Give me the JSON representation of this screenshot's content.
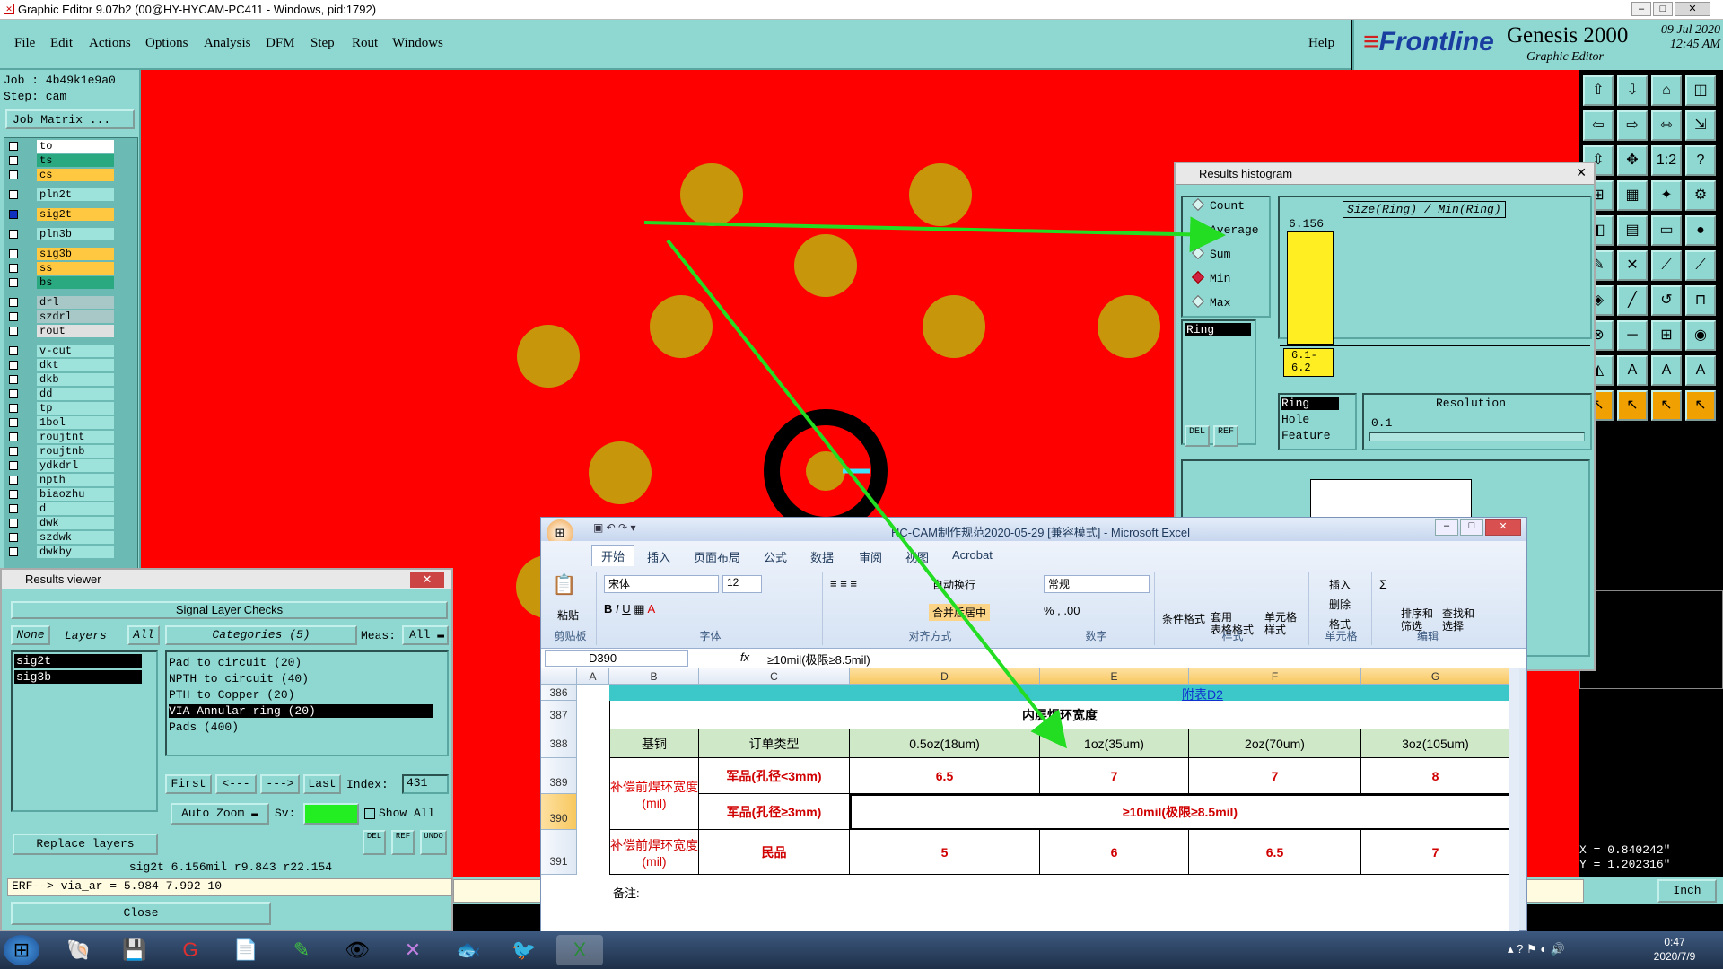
{
  "window": {
    "title": "Graphic Editor 9.07b2 (00@HY-HYCAM-PC411 - Windows, pid:1792)"
  },
  "menu": [
    "File",
    "Edit",
    "Actions",
    "Options",
    "Analysis",
    "DFM",
    "Step",
    "Rout",
    "Windows"
  ],
  "help": "Help",
  "brand": {
    "logo": "Frontline",
    "product": "Genesis 2000",
    "subtitle": "Graphic Editor",
    "date": "09 Jul 2020",
    "time": "12:45 AM"
  },
  "job": {
    "job_label": "Job : 4b49k1e9a0",
    "step_label": "Step: cam",
    "matrix_button": "Job Matrix ..."
  },
  "layers": [
    {
      "name": "to",
      "color": "#ffffff",
      "on": false
    },
    {
      "name": "ts",
      "color": "#2aa880",
      "on": false
    },
    {
      "name": "cs",
      "color": "#ffc840",
      "on": false
    },
    {
      "name": "pln2t",
      "color": "",
      "on": false
    },
    {
      "name": "sig2t",
      "color": "#ffc840",
      "on": true
    },
    {
      "name": "pln3b",
      "color": "",
      "on": false
    },
    {
      "name": "sig3b",
      "color": "#ffc840",
      "on": false
    },
    {
      "name": "ss",
      "color": "#ffc840",
      "on": false
    },
    {
      "name": "bs",
      "color": "#2aa880",
      "on": false
    },
    {
      "name": "drl",
      "color": "#a8c8c8",
      "on": false
    },
    {
      "name": "szdrl",
      "color": "#a8c8c8",
      "on": false
    },
    {
      "name": "rout",
      "color": "#e0e0e0",
      "on": false
    },
    {
      "name": "v-cut",
      "color": "",
      "on": false
    },
    {
      "name": "dkt",
      "color": "",
      "on": false
    },
    {
      "name": "dkb",
      "color": "",
      "on": false
    },
    {
      "name": "dd",
      "color": "",
      "on": false
    },
    {
      "name": "tp",
      "color": "",
      "on": false
    },
    {
      "name": "1bol",
      "color": "",
      "on": false
    },
    {
      "name": "roujtnt",
      "color": "",
      "on": false
    },
    {
      "name": "roujtnb",
      "color": "",
      "on": false
    },
    {
      "name": "ydkdrl",
      "color": "",
      "on": false
    },
    {
      "name": "npth",
      "color": "",
      "on": false
    },
    {
      "name": "biaozhu",
      "color": "",
      "on": false
    },
    {
      "name": "d",
      "color": "",
      "on": false
    },
    {
      "name": "dwk",
      "color": "",
      "on": false
    },
    {
      "name": "szdwk",
      "color": "",
      "on": false
    },
    {
      "name": "dwkby",
      "color": "",
      "on": false
    }
  ],
  "histogram": {
    "title": "Results histogram",
    "options": [
      "Count",
      "Average",
      "Sum",
      "Min",
      "Max"
    ],
    "selected": "Min",
    "chart_title": "Size(Ring) / Min(Ring)",
    "bar_value": "6.156",
    "bin_label_1": "6.1-",
    "bin_label_2": "6.2",
    "list_item": "Ring",
    "attr_items": [
      "Ring",
      "Hole",
      "Feature"
    ],
    "resolution_label": "Resolution",
    "resolution_value": "0.1",
    "del": "DEL",
    "ref": "REF"
  },
  "results_viewer": {
    "title": "Results viewer",
    "header": "Signal Layer Checks",
    "none_btn": "None",
    "layers_label": "Layers",
    "all_btn": "All",
    "categories_label": "Categories (5)",
    "meas_label": "Meas:",
    "meas_value": "All",
    "layers": [
      "sig2t",
      "sig3b"
    ],
    "categories": [
      "Pad to circuit (20)",
      "NPTH to circuit (40)",
      "PTH to Copper (20)",
      "VIA Annular ring (20)",
      "Pads (400)"
    ],
    "selected_category": "VIA Annular ring (20)",
    "nav": {
      "first": "First",
      "prev": "<---",
      "next": "--->",
      "last": "Last",
      "index_label": "Index:",
      "index": "431"
    },
    "auto_zoom": "Auto Zoom",
    "sv_label": "Sv:",
    "show_all": "Show All",
    "replace": "Replace layers",
    "del": "DEL",
    "ref": "REF",
    "undo": "UNDO",
    "status_line": "sig2t 6.156mil  r9.843  r22.154",
    "erf_line": "ERF--> via_ar = 5.984 7.992 10",
    "close": "Close"
  },
  "coords": {
    "x": "X = 0.840242\"",
    "y": "Y = 1.202316\"",
    "unit": "Inch"
  },
  "excel": {
    "title": "HC-CAM制作规范2020-05-29  [兼容模式] - Microsoft Excel",
    "tabs": [
      "开始",
      "插入",
      "页面布局",
      "公式",
      "数据",
      "审阅",
      "视图",
      "Acrobat"
    ],
    "font_name": "宋体",
    "font_size": "12",
    "wrap": "自动换行",
    "merge": "合并后居中",
    "number_fmt": "常规",
    "groups": [
      "剪贴板",
      "字体",
      "对齐方式",
      "数字",
      "样式",
      "单元格",
      "编辑"
    ],
    "style_btns": [
      "条件格式",
      "套用\n表格格式",
      "单元格\n样式"
    ],
    "cell_btns": [
      "插入",
      "删除",
      "格式"
    ],
    "edit_btns": [
      "排序和\n筛选",
      "查找和\n选择"
    ],
    "paste": "粘贴",
    "cell_ref": "D390",
    "formula": "≥10mil(极限≥8.5mil)",
    "columns": [
      "A",
      "B",
      "C",
      "D",
      "E",
      "F",
      "G"
    ],
    "rows": [
      "386",
      "387",
      "388",
      "389",
      "390",
      "391"
    ],
    "link": "附表D2",
    "sheet_title": "内层焊环宽度",
    "headers": [
      "基铜",
      "订单类型",
      "0.5oz(18um)",
      "1oz(35um)",
      "2oz(70um)",
      "3oz(105um)"
    ],
    "row389_label": "补偿前焊环宽度(mil)",
    "row389_type": "军品(孔径<3mm)",
    "row389_vals": [
      "6.5",
      "7",
      "7",
      "8"
    ],
    "row390_type": "军品(孔径≥3mm)",
    "row390_val": "≥10mil(极限≥8.5mil)",
    "row391_label": "补偿前焊环宽度(mil)",
    "row391_type": "民品",
    "row391_vals": [
      "5",
      "6",
      "6.5",
      "7"
    ],
    "note": "备注:"
  },
  "taskbar": {
    "time": "0:47",
    "date": "2020/7/9"
  },
  "colors": {
    "canvas": "#ff0000",
    "pad": "#c8960a",
    "panel": "#8fd8d2",
    "arrow": "#22dd22"
  }
}
